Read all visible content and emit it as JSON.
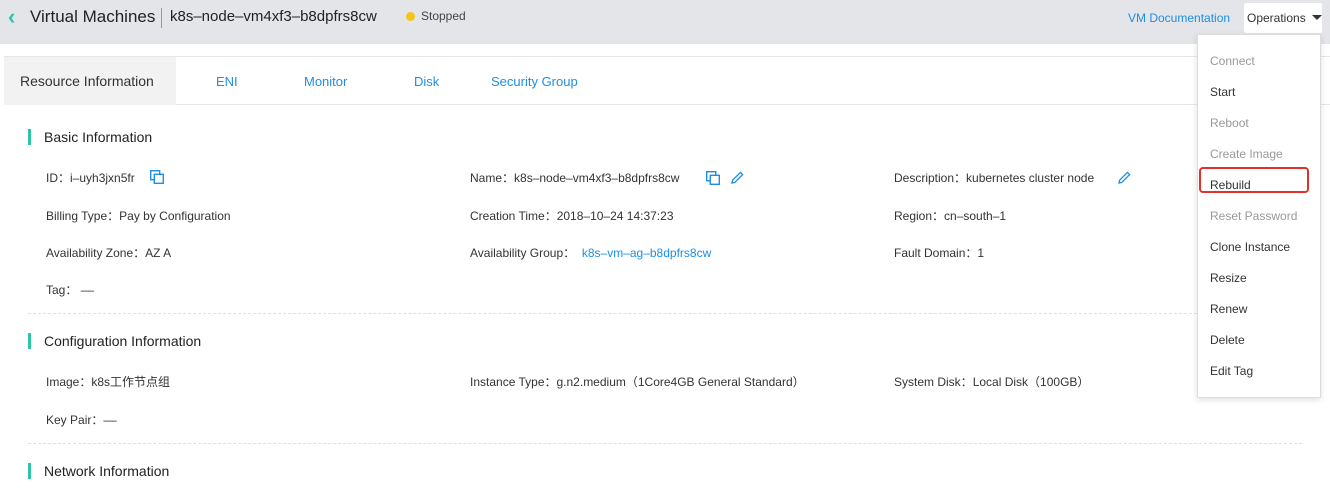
{
  "header": {
    "title": "Virtual Machines",
    "vm_name": "k8s–node–vm4xf3–b8dpfrs8cw",
    "status": "Stopped",
    "status_color": "#f5c518",
    "doc_link": "VM Documentation",
    "operations_label": "Operations",
    "accent_color": "#2fc4a6",
    "link_color": "#1e8ee6"
  },
  "tabs": [
    {
      "label": "Resource Information",
      "active": true
    },
    {
      "label": "ENI"
    },
    {
      "label": "Monitor"
    },
    {
      "label": "Disk"
    },
    {
      "label": "Security Group"
    }
  ],
  "basic": {
    "title": "Basic Information",
    "id_label": "ID：",
    "id_value": "i–uyh3jxn5fr",
    "name_label": "Name：",
    "name_value": "k8s–node–vm4xf3–b8dpfrs8cw",
    "description_label": "Description：",
    "description_value": "kubernetes cluster node",
    "billing_label": "Billing Type：",
    "billing_value": "Pay by Configuration",
    "creation_label": "Creation Time：",
    "creation_value": "2018–10–24 14:37:23",
    "region_label": "Region：",
    "region_value": "cn–south–1",
    "az_label": "Availability Zone：",
    "az_value": "AZ A",
    "ag_label": "Availability Group：",
    "ag_value": "k8s–vm–ag–b8dpfrs8cw",
    "fault_label": "Fault Domain：",
    "fault_value": "1",
    "tag_label": "Tag：",
    "tag_value": "––"
  },
  "config": {
    "title": "Configuration Information",
    "image_label": "Image：",
    "image_value": "k8s工作节点组",
    "instance_label": "Instance Type：",
    "instance_value": "g.n2.medium（1Core4GB General Standard）",
    "sysdisk_label": "System Disk：",
    "sysdisk_value": "Local Disk（100GB）",
    "keypair_label": "Key Pair：",
    "keypair_value": "––"
  },
  "network": {
    "title": "Network Information"
  },
  "menu": {
    "items": [
      {
        "label": "Connect",
        "disabled": true
      },
      {
        "label": "Start",
        "disabled": false
      },
      {
        "label": "Reboot",
        "disabled": true
      },
      {
        "label": "Create Image",
        "disabled": true
      },
      {
        "label": "Rebuild",
        "disabled": false,
        "highlighted": true
      },
      {
        "label": "Reset Password",
        "disabled": true
      },
      {
        "label": "Clone Instance",
        "disabled": false
      },
      {
        "label": "Resize",
        "disabled": false
      },
      {
        "label": "Renew",
        "disabled": false
      },
      {
        "label": "Delete",
        "disabled": false
      },
      {
        "label": "Edit Tag",
        "disabled": false
      }
    ]
  }
}
